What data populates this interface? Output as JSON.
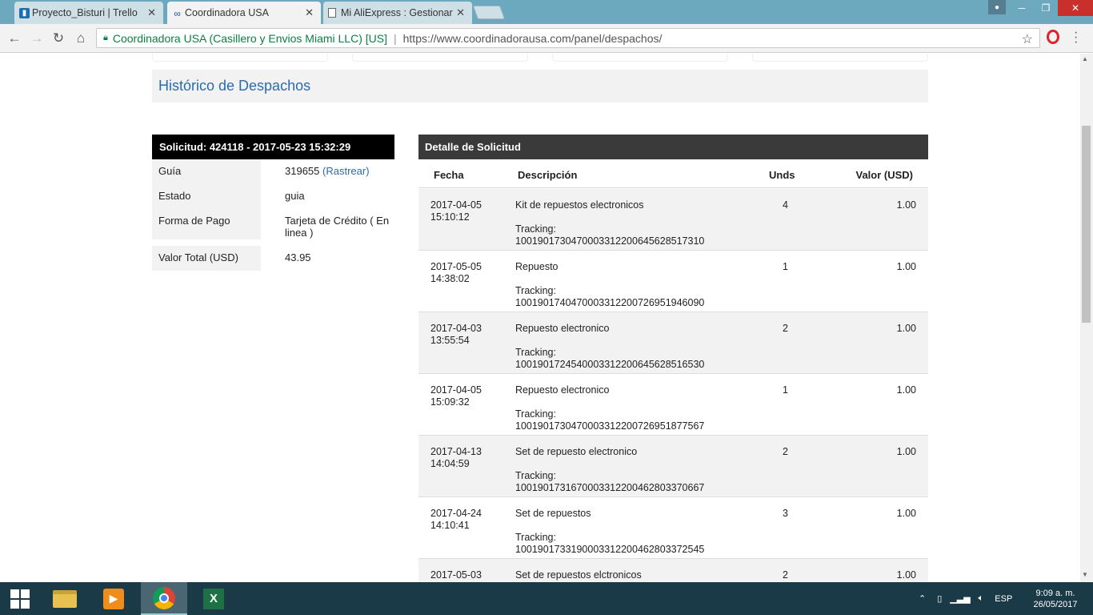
{
  "browser": {
    "tabs": [
      {
        "title": "Proyecto_Bisturi | Trello",
        "icon": "trello-icon"
      },
      {
        "title": "Coordinadora USA",
        "icon": "coordinadora-icon"
      },
      {
        "title": "Mi AliExpress : Gestionar",
        "icon": "page-icon"
      }
    ],
    "site_identity": "Coordinadora USA (Casillero y Envios Miami LLC) [US]",
    "url": "https://www.coordinadorausa.com/panel/despachos/"
  },
  "page": {
    "heading": "Histórico de Despachos",
    "solicitud": {
      "header": "Solicitud: 424118 - 2017-05-23 15:32:29",
      "fields": [
        {
          "label": "Guía",
          "value": "319655",
          "link": "(Rastrear)"
        },
        {
          "label": "Estado",
          "value": "guia"
        },
        {
          "label": "Forma de Pago",
          "value": "Tarjeta de Crédito ( En linea )"
        }
      ],
      "total_label": "Valor Total (USD)",
      "total_value": "43.95"
    },
    "detalle": {
      "header": "Detalle de Solicitud",
      "columns": {
        "fecha": "Fecha",
        "descripcion": "Descripción",
        "unds": "Unds",
        "valor": "Valor (USD)"
      },
      "tracking_label": "Tracking:",
      "rows": [
        {
          "date": "2017-04-05",
          "time": "15:10:12",
          "desc": "Kit de repuestos electronicos",
          "tracking": "10019017304700033122006456285173100",
          "units": "4",
          "value": "1.00"
        },
        {
          "date": "2017-05-05",
          "time": "14:38:02",
          "desc": "Repuesto",
          "tracking": "1001901740470003312200726951946090",
          "units": "1",
          "value": "1.00"
        },
        {
          "date": "2017-04-03",
          "time": "13:55:54",
          "desc": "Repuesto electronico",
          "tracking": "1001901724540003312200645628516530",
          "units": "2",
          "value": "1.00"
        },
        {
          "date": "2017-04-05",
          "time": "15:09:32",
          "desc": "Repuesto electronico",
          "tracking": "1001901730470003312200726951877567",
          "units": "1",
          "value": "1.00"
        },
        {
          "date": "2017-04-13",
          "time": "14:04:59",
          "desc": "Set de repuesto electronico",
          "tracking": "1001901731670003312200462803370667",
          "units": "2",
          "value": "1.00"
        },
        {
          "date": "2017-04-24",
          "time": "14:10:41",
          "desc": "Set de repuestos",
          "tracking": "1001901733190003312200462803372545",
          "units": "3",
          "value": "1.00"
        },
        {
          "date": "2017-05-03",
          "time": "",
          "desc": "Set de repuestos elctronicos",
          "tracking": "",
          "units": "2",
          "value": "1.00"
        }
      ]
    }
  },
  "taskbar": {
    "language": "ESP",
    "time": "9:09 a. m.",
    "date": "26/05/2017"
  }
}
